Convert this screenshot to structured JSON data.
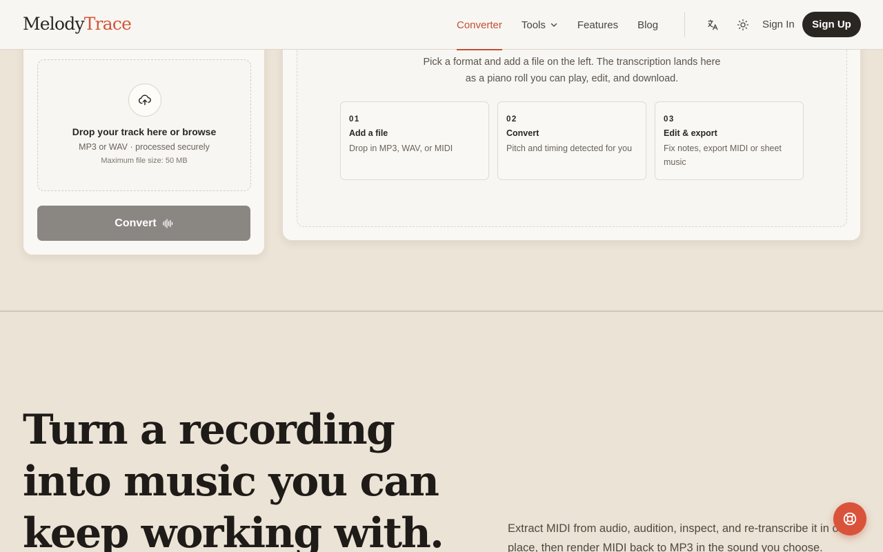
{
  "brand": {
    "name_a": "Melody",
    "name_b": "Trace",
    "accent_color": "#d2553a"
  },
  "nav": {
    "items": [
      {
        "label": "Converter",
        "active": true
      },
      {
        "label": "Tools",
        "has_dropdown": true
      },
      {
        "label": "Features"
      },
      {
        "label": "Blog"
      }
    ],
    "translate_icon": "translate-icon",
    "theme_icon": "sun-icon",
    "sign_in": "Sign In",
    "sign_up": "Sign Up"
  },
  "upload": {
    "icon": "cloud-upload-icon",
    "title": "Drop your track here or browse",
    "subtitle": "MP3 or WAV · processed securely",
    "max_size": "Maximum file size: 50 MB",
    "convert_label": "Convert",
    "convert_icon": "waveform-icon"
  },
  "result": {
    "line1": "Pick a format and add a file on the left. The transcription lands here",
    "line2": "as a piano roll you can play, edit, and download.",
    "steps": [
      {
        "num": "01",
        "title": "Add a file",
        "desc": "Drop in MP3, WAV, or MIDI"
      },
      {
        "num": "02",
        "title": "Convert",
        "desc": "Pitch and timing detected for you"
      },
      {
        "num": "03",
        "title": "Edit & export",
        "desc": "Fix notes, export MIDI or sheet music"
      }
    ]
  },
  "hero": {
    "title_line1": "Turn a recording",
    "title_line2": "into music you can",
    "title_line3": "keep working with.",
    "description": "Extract MIDI from audio, audition, inspect, and re-transcribe it in one place, then render MIDI back to MP3 in the sound you choose."
  },
  "help": {
    "icon": "lifebuoy-icon"
  }
}
